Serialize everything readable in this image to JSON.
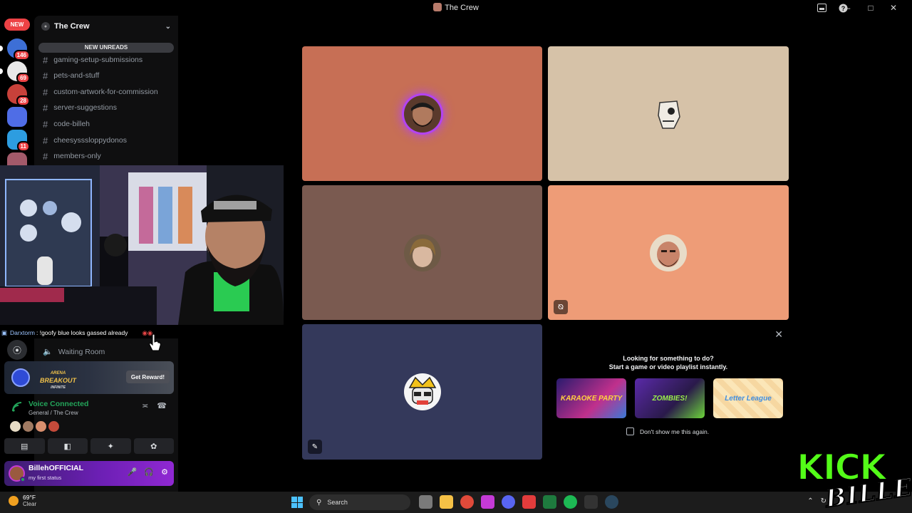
{
  "window": {
    "title": "The Crew"
  },
  "rail": {
    "new_badge": "NEW",
    "badges": [
      "146",
      "69",
      "28",
      "11"
    ]
  },
  "sidebar": {
    "server_name": "The Crew",
    "new_unreads": "NEW UNREADS",
    "channels": [
      "gaming-setup-submissions",
      "pets-and-stuff",
      "custom-artwork-for-commission",
      "server-suggestions",
      "code-billeh",
      "cheesysssloppydonos",
      "members-only"
    ],
    "voice_channel": "Waiting Room"
  },
  "stream_chat": {
    "user": "Darxtorm",
    "message": ": !goofy blue looks gassed already"
  },
  "promo": {
    "brand_line1": "ARENA",
    "brand_line2": "BREAKOUT",
    "brand_line3": "INFINITE",
    "button": "Get Reward!"
  },
  "voice": {
    "status": "Voice Connected",
    "location": "General / The Crew"
  },
  "user": {
    "name": "BillehOFFICIAL",
    "status": "my first status"
  },
  "activity": {
    "line1": "Looking for something to do?",
    "line2": "Start a game or video playlist instantly.",
    "cards": [
      "KARAOKE PARTY",
      "ZOMBIES!",
      "Letter League"
    ],
    "checkbox_label": "Don't show me this again."
  },
  "taskbar": {
    "temperature": "69°F",
    "condition": "Clear",
    "search_placeholder": "Search"
  },
  "overlay": {
    "kick": "KICK",
    "billeh": "BILLEH"
  },
  "colors": {
    "tile1": "#c76f55",
    "tile2": "#d6c2a8",
    "tile3": "#7a5a50",
    "tile4": "#ee9c77",
    "tile5": "#34395b",
    "speaking_ring": "#b343f2",
    "voice_green": "#23a55a",
    "kick_green": "#53fc18"
  }
}
